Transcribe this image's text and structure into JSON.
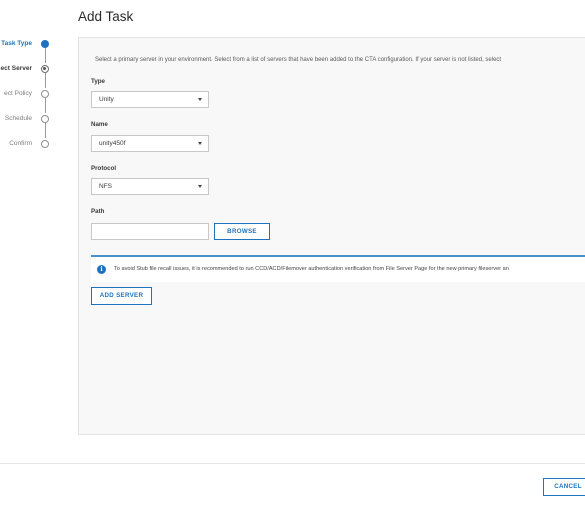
{
  "dialog": {
    "title": "Add Task"
  },
  "steps": [
    {
      "label": "Task Type",
      "state": "done"
    },
    {
      "label": "ect Server",
      "state": "current"
    },
    {
      "label": "ect Policy",
      "state": "pending"
    },
    {
      "label": "Schedule",
      "state": "pending"
    },
    {
      "label": "Confirm",
      "state": "pending"
    }
  ],
  "form": {
    "intro": "Select a primary server in your environment. Select from a list of servers that have been added to the CTA configuration. If your server is not listed, select",
    "type": {
      "label": "Type",
      "value": "Unity"
    },
    "name": {
      "label": "Name",
      "value": "unity450f"
    },
    "protocol": {
      "label": "Protocol",
      "value": "NFS"
    },
    "path": {
      "label": "Path",
      "value": "",
      "browse_label": "BROWSE"
    },
    "notice": "To avoid Stub file recall issues, it is recommended to run CCD/ACD/Filemover authentication verification from File Server Page for the new primary fileserver an",
    "add_server_label": "ADD SERVER"
  },
  "footer": {
    "cancel_label": "CANCEL"
  },
  "colors": {
    "accent": "#1f72bd",
    "panel_bg": "#f8f8f8"
  }
}
